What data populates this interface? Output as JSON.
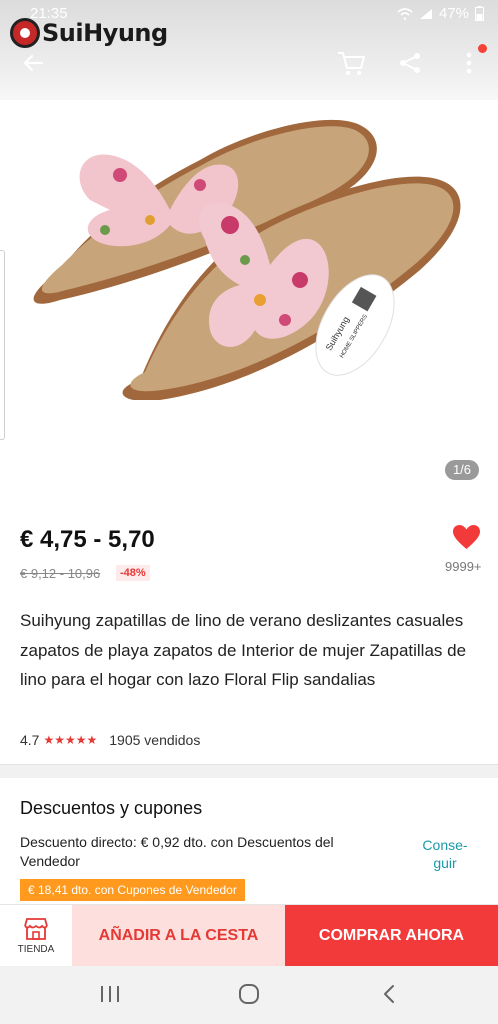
{
  "status_bar": {
    "time": "21:35",
    "battery": "47%"
  },
  "brand": {
    "name": "SuiHyung"
  },
  "gallery": {
    "page_indicator": "1/6"
  },
  "tag": {
    "brand": "Suihyung",
    "subtitle": "HOME SLIPPERS"
  },
  "product": {
    "price": "€ 4,75 - 5,70",
    "old_price": "€ 9,12 - 10,96",
    "discount": "-48%",
    "wish_count": "9999+",
    "title": "Suihyung zapatillas de lino de verano deslizantes casuales zapatos de playa zapatos de Interior de mujer Zapatillas de lino para el hogar con lazo Floral Flip sandalias",
    "rating": "4.7",
    "stars": "★★★★★",
    "sold": "1905 vendidos"
  },
  "coupons": {
    "section_title": "Descuentos y cupones",
    "direct_discount": "Descuento directo: € 0,92 dto. con Descuentos del Vendedor",
    "get_label": "Conse-guir",
    "coupon_tag": "€ 18,41 dto. con Cupones de Vendedor"
  },
  "actions": {
    "store_label": "TIENDA",
    "add_to_cart": "AÑADIR A LA CESTA",
    "buy_now": "COMPRAR AHORA"
  },
  "colors": {
    "accent_red": "#f23a3a",
    "link_teal": "#1a9aa8",
    "coupon_orange": "#ff9a1f"
  },
  "icons": [
    "back-arrow-icon",
    "cart-icon",
    "share-icon",
    "more-vert-icon",
    "heart-icon",
    "store-icon",
    "nav-recent-icon",
    "nav-home-icon",
    "nav-back-icon"
  ]
}
